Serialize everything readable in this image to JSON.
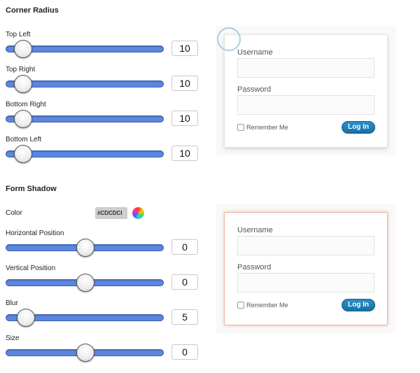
{
  "corner_radius": {
    "title": "Corner Radius",
    "sliders": [
      {
        "label": "Top Left",
        "value": "10",
        "fraction": 0.05
      },
      {
        "label": "Top Right",
        "value": "10",
        "fraction": 0.05
      },
      {
        "label": "Bottom Right",
        "value": "10",
        "fraction": 0.05
      },
      {
        "label": "Bottom Left",
        "value": "10",
        "fraction": 0.05
      }
    ]
  },
  "form_shadow": {
    "title": "Form Shadow",
    "color_label": "Color",
    "color_value": "#CDCDCD",
    "color_value_display": "#CDCDCI",
    "sliders": [
      {
        "label": "Horizontal Position",
        "value": "0",
        "fraction": 0.5
      },
      {
        "label": "Vertical Position",
        "value": "0",
        "fraction": 0.5
      },
      {
        "label": "Blur",
        "value": "5",
        "fraction": 0.07
      },
      {
        "label": "Size",
        "value": "0",
        "fraction": 0.5
      }
    ]
  },
  "preview": {
    "username_label": "Username",
    "password_label": "Password",
    "remember_label": "Remember Me",
    "login_label": "Log In"
  },
  "colors": {
    "slider_track": "#5b87e0",
    "login_button": "#1f7db8",
    "shadow_highlight": "#eab6a0"
  }
}
